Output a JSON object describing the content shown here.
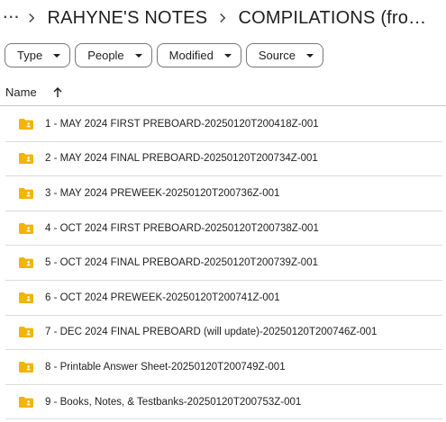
{
  "breadcrumb": {
    "more": "···",
    "items": [
      "RAHYNE'S NOTES",
      "COMPILATIONS (from X..."
    ]
  },
  "filters": [
    "Type",
    "People",
    "Modified",
    "Source"
  ],
  "list_header": {
    "name": "Name",
    "sort": "ascending"
  },
  "folders": [
    "1 - MAY 2024 FIRST PREBOARD-20250120T200418Z-001",
    "2 - MAY 2024 FINAL PREBOARD-20250120T200734Z-001",
    "3 - MAY 2024 PREWEEK-20250120T200736Z-001",
    "4 - OCT 2024 FIRST PREBOARD-20250120T200738Z-001",
    "5 - OCT 2024 FINAL PREBOARD-20250120T200739Z-001",
    "6 - OCT 2024 PREWEEK-20250120T200741Z-001",
    "7 - DEC 2024 FINAL PREBOARD (will update)-20250120T200746Z-001",
    "8 - Printable Answer Sheet-20250120T200749Z-001",
    "9 - Books, Notes, & Testbanks-20250120T200753Z-001"
  ],
  "colors": {
    "folder": "#f4b400",
    "text": "#1f1f1f",
    "border": "#747775"
  }
}
